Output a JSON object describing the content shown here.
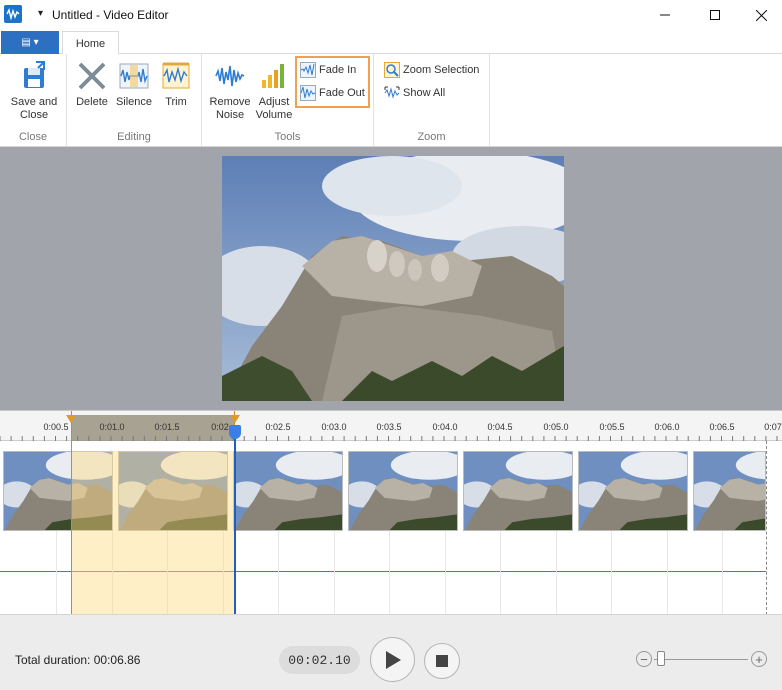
{
  "window": {
    "title": "Untitled - Video Editor",
    "quick_access_arrow": "▾"
  },
  "ribbon_tabs": {
    "file_label": "▤ ▾",
    "home": "Home"
  },
  "ribbon": {
    "close_group": {
      "label": "Close",
      "save_close_line1": "Save and",
      "save_close_line2": "Close"
    },
    "editing_group": {
      "label": "Editing",
      "delete": "Delete",
      "silence": "Silence",
      "trim": "Trim"
    },
    "tools_group": {
      "label": "Tools",
      "remove_noise_line1": "Remove",
      "remove_noise_line2": "Noise",
      "adjust_volume_line1": "Adjust",
      "adjust_volume_line2": "Volume",
      "fade_in": "Fade In",
      "fade_out": "Fade Out"
    },
    "zoom_group": {
      "label": "Zoom",
      "zoom_selection": "Zoom Selection",
      "show_all": "Show All"
    }
  },
  "timeline": {
    "ticks": [
      "0:00.5",
      "0:01.0",
      "0:01.5",
      "0:02",
      "0:02.5",
      "0:03.0",
      "0:03.5",
      "0:04.0",
      "0:04.5",
      "0:05.0",
      "0:05.5",
      "0:06.0",
      "0:06.5",
      "0:07"
    ]
  },
  "bottom": {
    "total_duration": "Total duration: 00:06.86",
    "current_time": "00:02.10",
    "zoom_minus": "−",
    "zoom_plus": "+"
  },
  "colors": {
    "accent": "#2d6fc1",
    "selection": "#ffdc82",
    "fade_highlight": "#f0a050",
    "playhead": "#1e5fc4",
    "wave": "#2e8b8b"
  }
}
